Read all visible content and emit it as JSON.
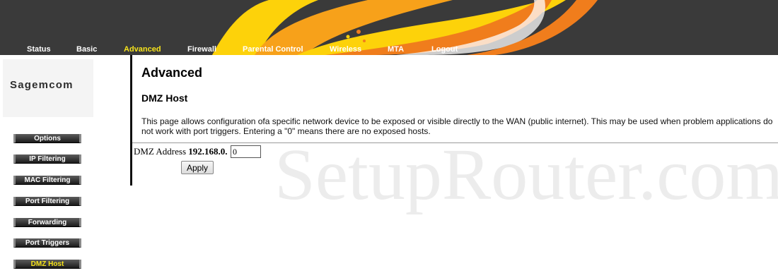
{
  "nav": {
    "items": [
      {
        "label": "Status"
      },
      {
        "label": "Basic"
      },
      {
        "label": "Advanced",
        "active": true
      },
      {
        "label": "Firewall"
      },
      {
        "label": "Parental Control"
      },
      {
        "label": "Wireless"
      },
      {
        "label": "MTA"
      },
      {
        "label": "Logout"
      }
    ]
  },
  "brand": {
    "logo_text": "Sagemcom"
  },
  "sidebar": {
    "items": [
      {
        "label": "Options"
      },
      {
        "label": "IP Filtering"
      },
      {
        "label": "MAC Filtering"
      },
      {
        "label": "Port Filtering"
      },
      {
        "label": "Forwarding"
      },
      {
        "label": "Port Triggers"
      },
      {
        "label": "DMZ Host",
        "active": true
      }
    ]
  },
  "main": {
    "title": "Advanced",
    "section": "DMZ Host",
    "description": "This page allows configuration ofa specific network device to be exposed or visible directly to the WAN (public internet). This may be used when problem applications do not work with port triggers. Entering a \"0\" means there are no exposed hosts.",
    "dmz": {
      "label": "DMZ Address",
      "prefix": "192.168.0.",
      "value": "0"
    },
    "apply_label": "Apply"
  },
  "watermark": "SetupRouter.com",
  "colors": {
    "header_bg": "#3a3a3a",
    "active_nav": "#f6e31b",
    "flame_orange": "#f07d1c",
    "flame_yellow": "#fdd20a"
  }
}
